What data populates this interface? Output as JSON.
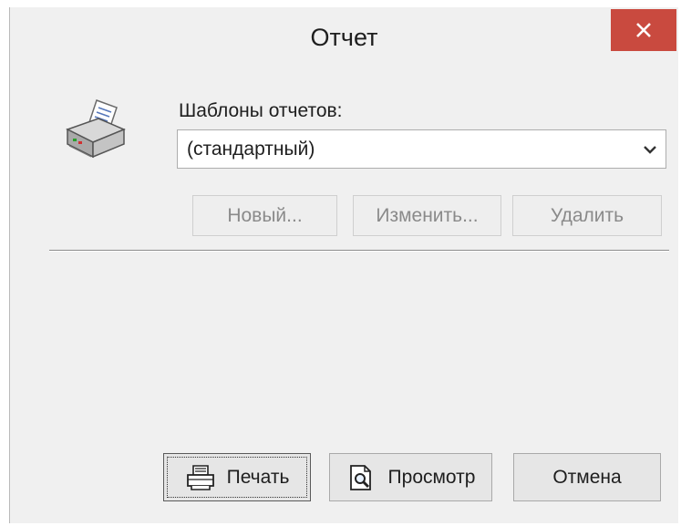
{
  "window": {
    "title": "Отчет",
    "close_label": "×"
  },
  "templates": {
    "label": "Шаблоны отчетов:",
    "selected": "(стандартный)"
  },
  "template_buttons": {
    "new": "Новый...",
    "edit": "Изменить...",
    "delete": "Удалить"
  },
  "footer_buttons": {
    "print": "Печать",
    "preview": "Просмотр",
    "cancel": "Отмена"
  },
  "icons": {
    "app": "printer-icon",
    "close": "close-icon",
    "dropdown": "chevron-down-icon",
    "print": "printer-icon",
    "preview": "document-magnifier-icon"
  },
  "colors": {
    "close_button": "#c94a3f",
    "window_bg": "#f0f0f0"
  }
}
